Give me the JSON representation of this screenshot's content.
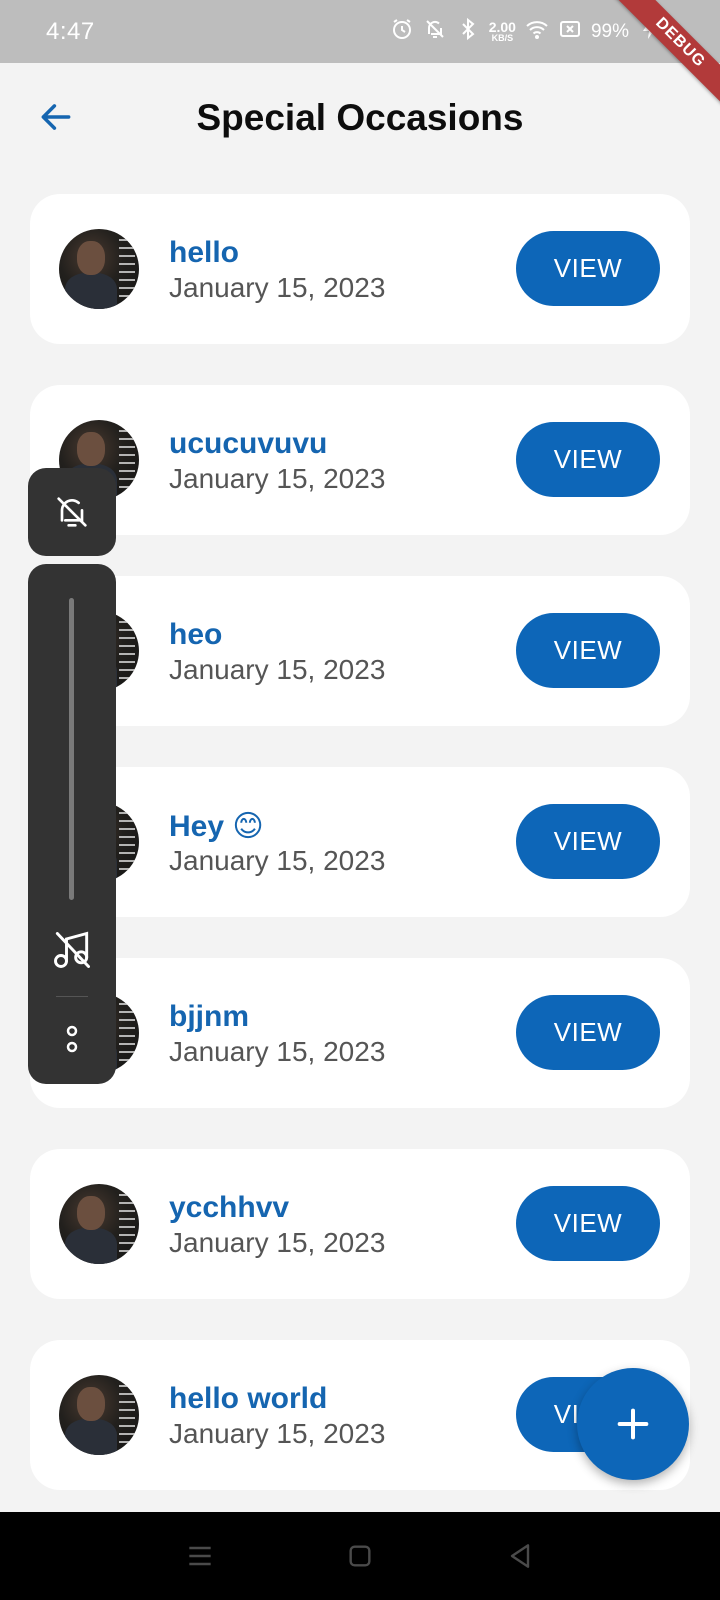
{
  "status_bar": {
    "time": "4:47",
    "net_speed_value": "2.00",
    "net_speed_unit": "KB/S",
    "battery": "99%",
    "icons": [
      "alarm-icon",
      "bell-off-icon",
      "bluetooth-icon",
      "wifi-icon",
      "sim-off-icon",
      "battery-charging-icon"
    ]
  },
  "debug_banner": "DEBUG",
  "app_bar": {
    "title": "Special Occasions",
    "back_icon": "arrow-back-icon"
  },
  "occasions": [
    {
      "name": "hello",
      "date": "January 15, 2023",
      "action": "VIEW"
    },
    {
      "name": "ucucuvuvu",
      "date": "January 15, 2023",
      "action": "VIEW"
    },
    {
      "name": "heo",
      "date": "January 15, 2023",
      "action": "VIEW"
    },
    {
      "name": "Hey 😊",
      "date": "January 15, 2023",
      "action": "VIEW"
    },
    {
      "name": "bjjnm",
      "date": "January 15, 2023",
      "action": "VIEW"
    },
    {
      "name": "ycchhvv",
      "date": "January 15, 2023",
      "action": "VIEW"
    },
    {
      "name": "hello world",
      "date": "January 15, 2023",
      "action": "VIEW"
    }
  ],
  "volume_overlay": {
    "icons": [
      "bell-off-icon",
      "music-off-icon",
      "more-icon"
    ]
  },
  "fab": {
    "icon": "plus-icon"
  },
  "colors": {
    "accent": "#0d66b8",
    "name_text": "#1565b0",
    "background": "#f3f3f3",
    "card": "#ffffff",
    "status_bar": "#bdbdbd",
    "overlay": "#333333"
  }
}
